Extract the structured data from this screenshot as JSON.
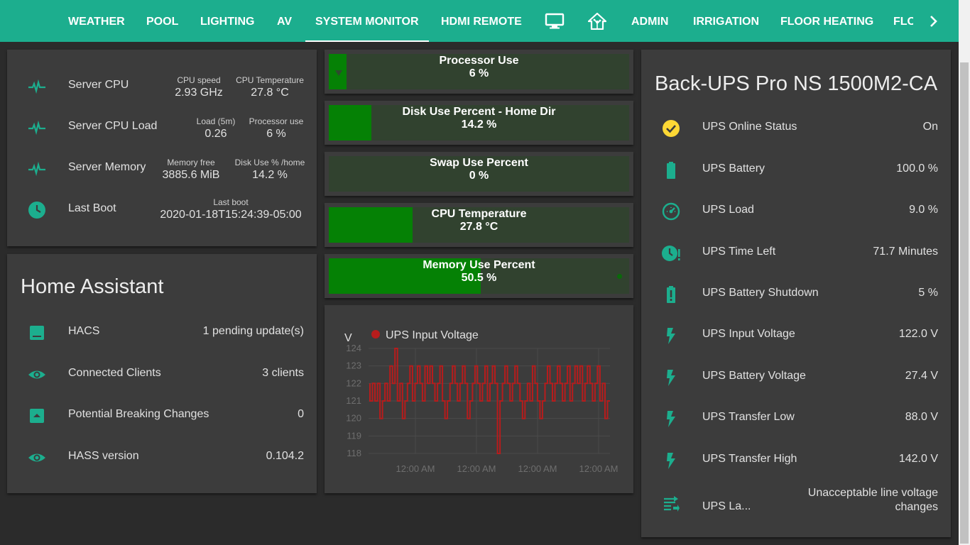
{
  "nav": {
    "tabs": [
      {
        "label": "WEATHER",
        "active": false
      },
      {
        "label": "POOL",
        "active": false
      },
      {
        "label": "LIGHTING",
        "active": false
      },
      {
        "label": "AV",
        "active": false
      },
      {
        "label": "SYSTEM MONITOR",
        "active": true
      },
      {
        "label": "HDMI REMOTE",
        "active": false
      },
      {
        "label": "ADMIN",
        "active": false
      },
      {
        "label": "IRRIGATION",
        "active": false
      },
      {
        "label": "FLOOR HEATING",
        "active": false
      },
      {
        "label": "FLO",
        "active": false
      }
    ],
    "icons": [
      "monitor-icon",
      "home-assistant-icon",
      "chevron-right-icon"
    ]
  },
  "server": {
    "rows": [
      {
        "name": "Server CPU",
        "icon": "pulse-icon",
        "attrs": [
          {
            "label": "CPU speed",
            "value": "2.93 GHz"
          },
          {
            "label": "CPU Temperature",
            "value": "27.8 °C"
          }
        ]
      },
      {
        "name": "Server CPU Load",
        "icon": "pulse-icon",
        "attrs": [
          {
            "label": "Load (5m)",
            "value": "0.26"
          },
          {
            "label": "Processor use",
            "value": "6 %"
          }
        ]
      },
      {
        "name": "Server Memory",
        "icon": "pulse-icon",
        "attrs": [
          {
            "label": "Memory free",
            "value": "3885.6 MiB"
          },
          {
            "label": "Disk Use % /home",
            "value": "14.2 %"
          }
        ]
      },
      {
        "name": "Last Boot",
        "icon": "clock-icon",
        "attrs": [
          {
            "label": "Last boot",
            "value": "2020-01-18T15:24:39-05:00"
          }
        ]
      }
    ]
  },
  "home_assistant": {
    "title": "Home Assistant",
    "rows": [
      {
        "name": "HACS",
        "state": "1 pending update(s)",
        "icon": "package-icon"
      },
      {
        "name": "Connected Clients",
        "state": "3 clients",
        "icon": "eye-icon"
      },
      {
        "name": "Potential Breaking Changes",
        "state": "0",
        "icon": "package-up-icon"
      },
      {
        "name": "HASS version",
        "state": "0.104.2",
        "icon": "eye-icon"
      }
    ]
  },
  "gauges": [
    {
      "title": "Processor Use",
      "value": "6 %",
      "fraction": 0.06
    },
    {
      "title": "Disk Use Percent - Home Dir",
      "value": "14.2 %",
      "fraction": 0.142
    },
    {
      "title": "Swap Use Percent",
      "value": "0 %",
      "fraction": 0.0
    },
    {
      "title": "CPU Temperature",
      "value": "27.8 °C",
      "fraction": 0.278
    },
    {
      "title": "Memory Use Percent",
      "value": "50.5 %",
      "fraction": 0.505
    }
  ],
  "chart_data": {
    "type": "line",
    "unit_label": "V",
    "series": [
      {
        "name": "UPS Input Voltage",
        "color": "#b71c1c",
        "values": [
          122,
          121,
          122,
          121,
          122,
          120,
          121,
          122,
          121,
          123,
          122,
          124,
          121,
          122,
          120,
          121,
          122,
          123,
          121,
          122,
          123,
          122,
          121,
          123,
          122,
          123,
          122,
          121,
          122,
          123,
          121,
          120,
          121,
          122,
          123,
          122,
          121,
          122,
          123,
          122,
          120,
          121,
          122,
          123,
          122,
          121,
          122,
          123,
          121,
          122,
          123,
          122,
          118,
          121,
          122,
          123,
          122,
          121,
          122,
          123,
          122,
          121,
          120,
          121,
          122,
          121,
          123,
          122,
          121,
          120,
          121,
          122,
          123,
          122,
          121,
          122,
          123,
          122,
          121,
          122,
          123,
          121,
          122,
          123,
          122,
          123,
          121,
          122,
          123,
          122,
          121,
          122,
          123,
          121,
          122,
          120,
          121
        ]
      }
    ],
    "ylim": [
      118,
      124
    ],
    "yticks": [
      "124",
      "123",
      "122",
      "121",
      "120",
      "119",
      "118"
    ],
    "xticks": [
      "12:00 AM",
      "12:00 AM",
      "12:00 AM",
      "12:00 AM"
    ],
    "grid": true,
    "legend": "top-left"
  },
  "ups": {
    "title": "Back-UPS Pro NS 1500M2-CA",
    "rows": [
      {
        "name": "UPS Online Status",
        "state": "On",
        "icon": "check-circle-icon"
      },
      {
        "name": "UPS Battery",
        "state": "100.0 %",
        "icon": "battery-icon"
      },
      {
        "name": "UPS Load",
        "state": "9.0 %",
        "icon": "gauge-icon"
      },
      {
        "name": "UPS Time Left",
        "state": "71.7 Minutes",
        "icon": "clock-alert-icon"
      },
      {
        "name": "UPS Battery Shutdown",
        "state": "5 %",
        "icon": "battery-alert-icon"
      },
      {
        "name": "UPS Input Voltage",
        "state": "122.0 V",
        "icon": "flash-icon"
      },
      {
        "name": "UPS Battery Voltage",
        "state": "27.4 V",
        "icon": "flash-icon"
      },
      {
        "name": "UPS Transfer Low",
        "state": "88.0 V",
        "icon": "flash-icon"
      },
      {
        "name": "UPS Transfer High",
        "state": "142.0 V",
        "icon": "flash-icon"
      },
      {
        "name": "UPS La...",
        "state_line1": "Unacceptable line voltage",
        "state_line2": "changes",
        "icon": "transfer-icon"
      }
    ]
  },
  "colors": {
    "accent": "#1cae8e",
    "icon": "#1cae8e",
    "ok": "#fdd835",
    "gauge_fill": "#058105",
    "gauge_track": "#31422f",
    "line": "#b71c1c"
  }
}
